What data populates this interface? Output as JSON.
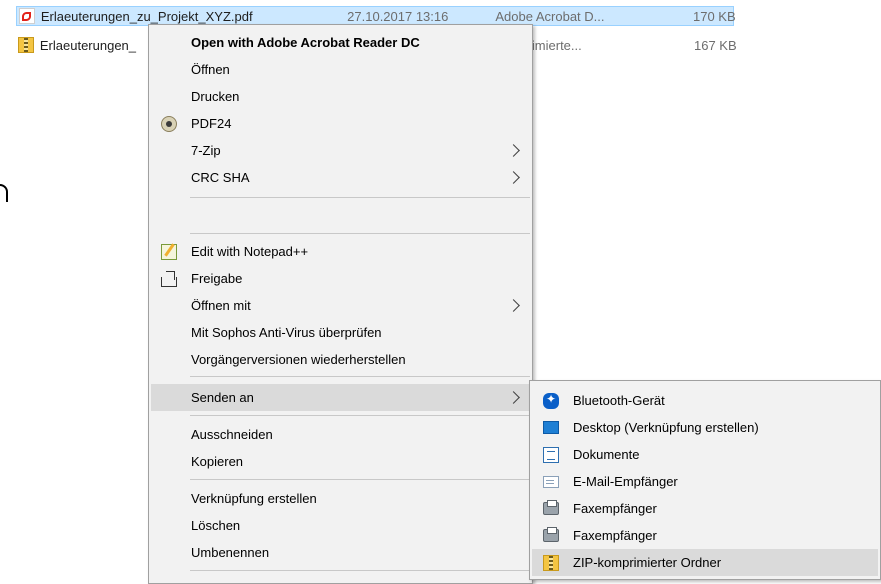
{
  "files": [
    {
      "name": "Erlaeuterungen_zu_Projekt_XYZ.pdf",
      "date": "27.10.2017 13:16",
      "type": "Adobe Acrobat D...",
      "size": "170 KB",
      "icon": "pdf-file-icon"
    },
    {
      "name": "Erlaeuterungen_",
      "date": "",
      "type": "komprimierte...",
      "size": "167 KB",
      "icon": "zip-folder-icon"
    }
  ],
  "context_menu": {
    "open_with_acrobat": "Open with Adobe Acrobat Reader DC",
    "oeffnen": "Öffnen",
    "drucken": "Drucken",
    "pdf24": "PDF24",
    "seven_zip": "7-Zip",
    "crc_sha": "CRC SHA",
    "edit_notepad": "Edit with Notepad++",
    "freigabe": "Freigabe",
    "oeffnen_mit": "Öffnen mit",
    "sophos": "Mit Sophos Anti-Virus überprüfen",
    "vorgaenger": "Vorgängerversionen wiederherstellen",
    "senden_an": "Senden an",
    "ausschneiden": "Ausschneiden",
    "kopieren": "Kopieren",
    "verknuepfung": "Verknüpfung erstellen",
    "loeschen": "Löschen",
    "umbenennen": "Umbenennen"
  },
  "send_to_menu": {
    "bluetooth": "Bluetooth-Gerät",
    "desktop": "Desktop (Verknüpfung erstellen)",
    "dokumente": "Dokumente",
    "email": "E-Mail-Empfänger",
    "fax1": "Faxempfänger",
    "fax2": "Faxempfänger",
    "zip": "ZIP-komprimierter Ordner"
  },
  "colors": {
    "selection_bg": "#cce8ff",
    "menu_bg": "#f2f2f2",
    "hover_bg": "#dadada",
    "pdf_red": "#e2231a"
  }
}
